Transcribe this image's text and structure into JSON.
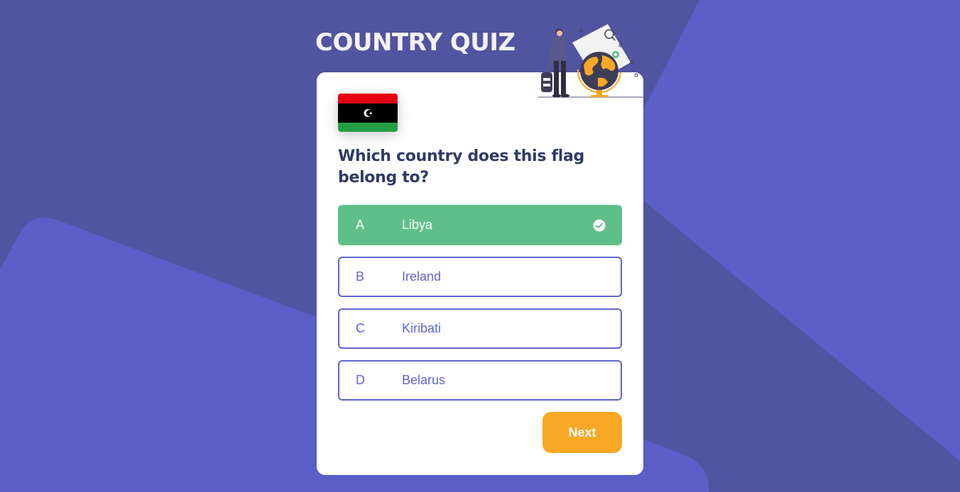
{
  "app": {
    "title": "COUNTRY QUIZ"
  },
  "quiz": {
    "flag_country": "Libya",
    "question": "Which country does this flag belong to?",
    "options": [
      {
        "letter": "A",
        "text": "Libya",
        "state": "correct"
      },
      {
        "letter": "B",
        "text": "Ireland",
        "state": "default"
      },
      {
        "letter": "C",
        "text": "Kiribati",
        "state": "default"
      },
      {
        "letter": "D",
        "text": "Belarus",
        "state": "default"
      }
    ],
    "next_label": "Next"
  },
  "icons": {
    "correct": "check-circle-icon",
    "hero": "traveler-globe-illustration"
  },
  "colors": {
    "background": "#5b5fc7",
    "background_shade": "#5154a0",
    "primary": "#6066d0",
    "correct": "#60bf88",
    "accent": "#f9a826",
    "heading": "#2f3b66"
  }
}
